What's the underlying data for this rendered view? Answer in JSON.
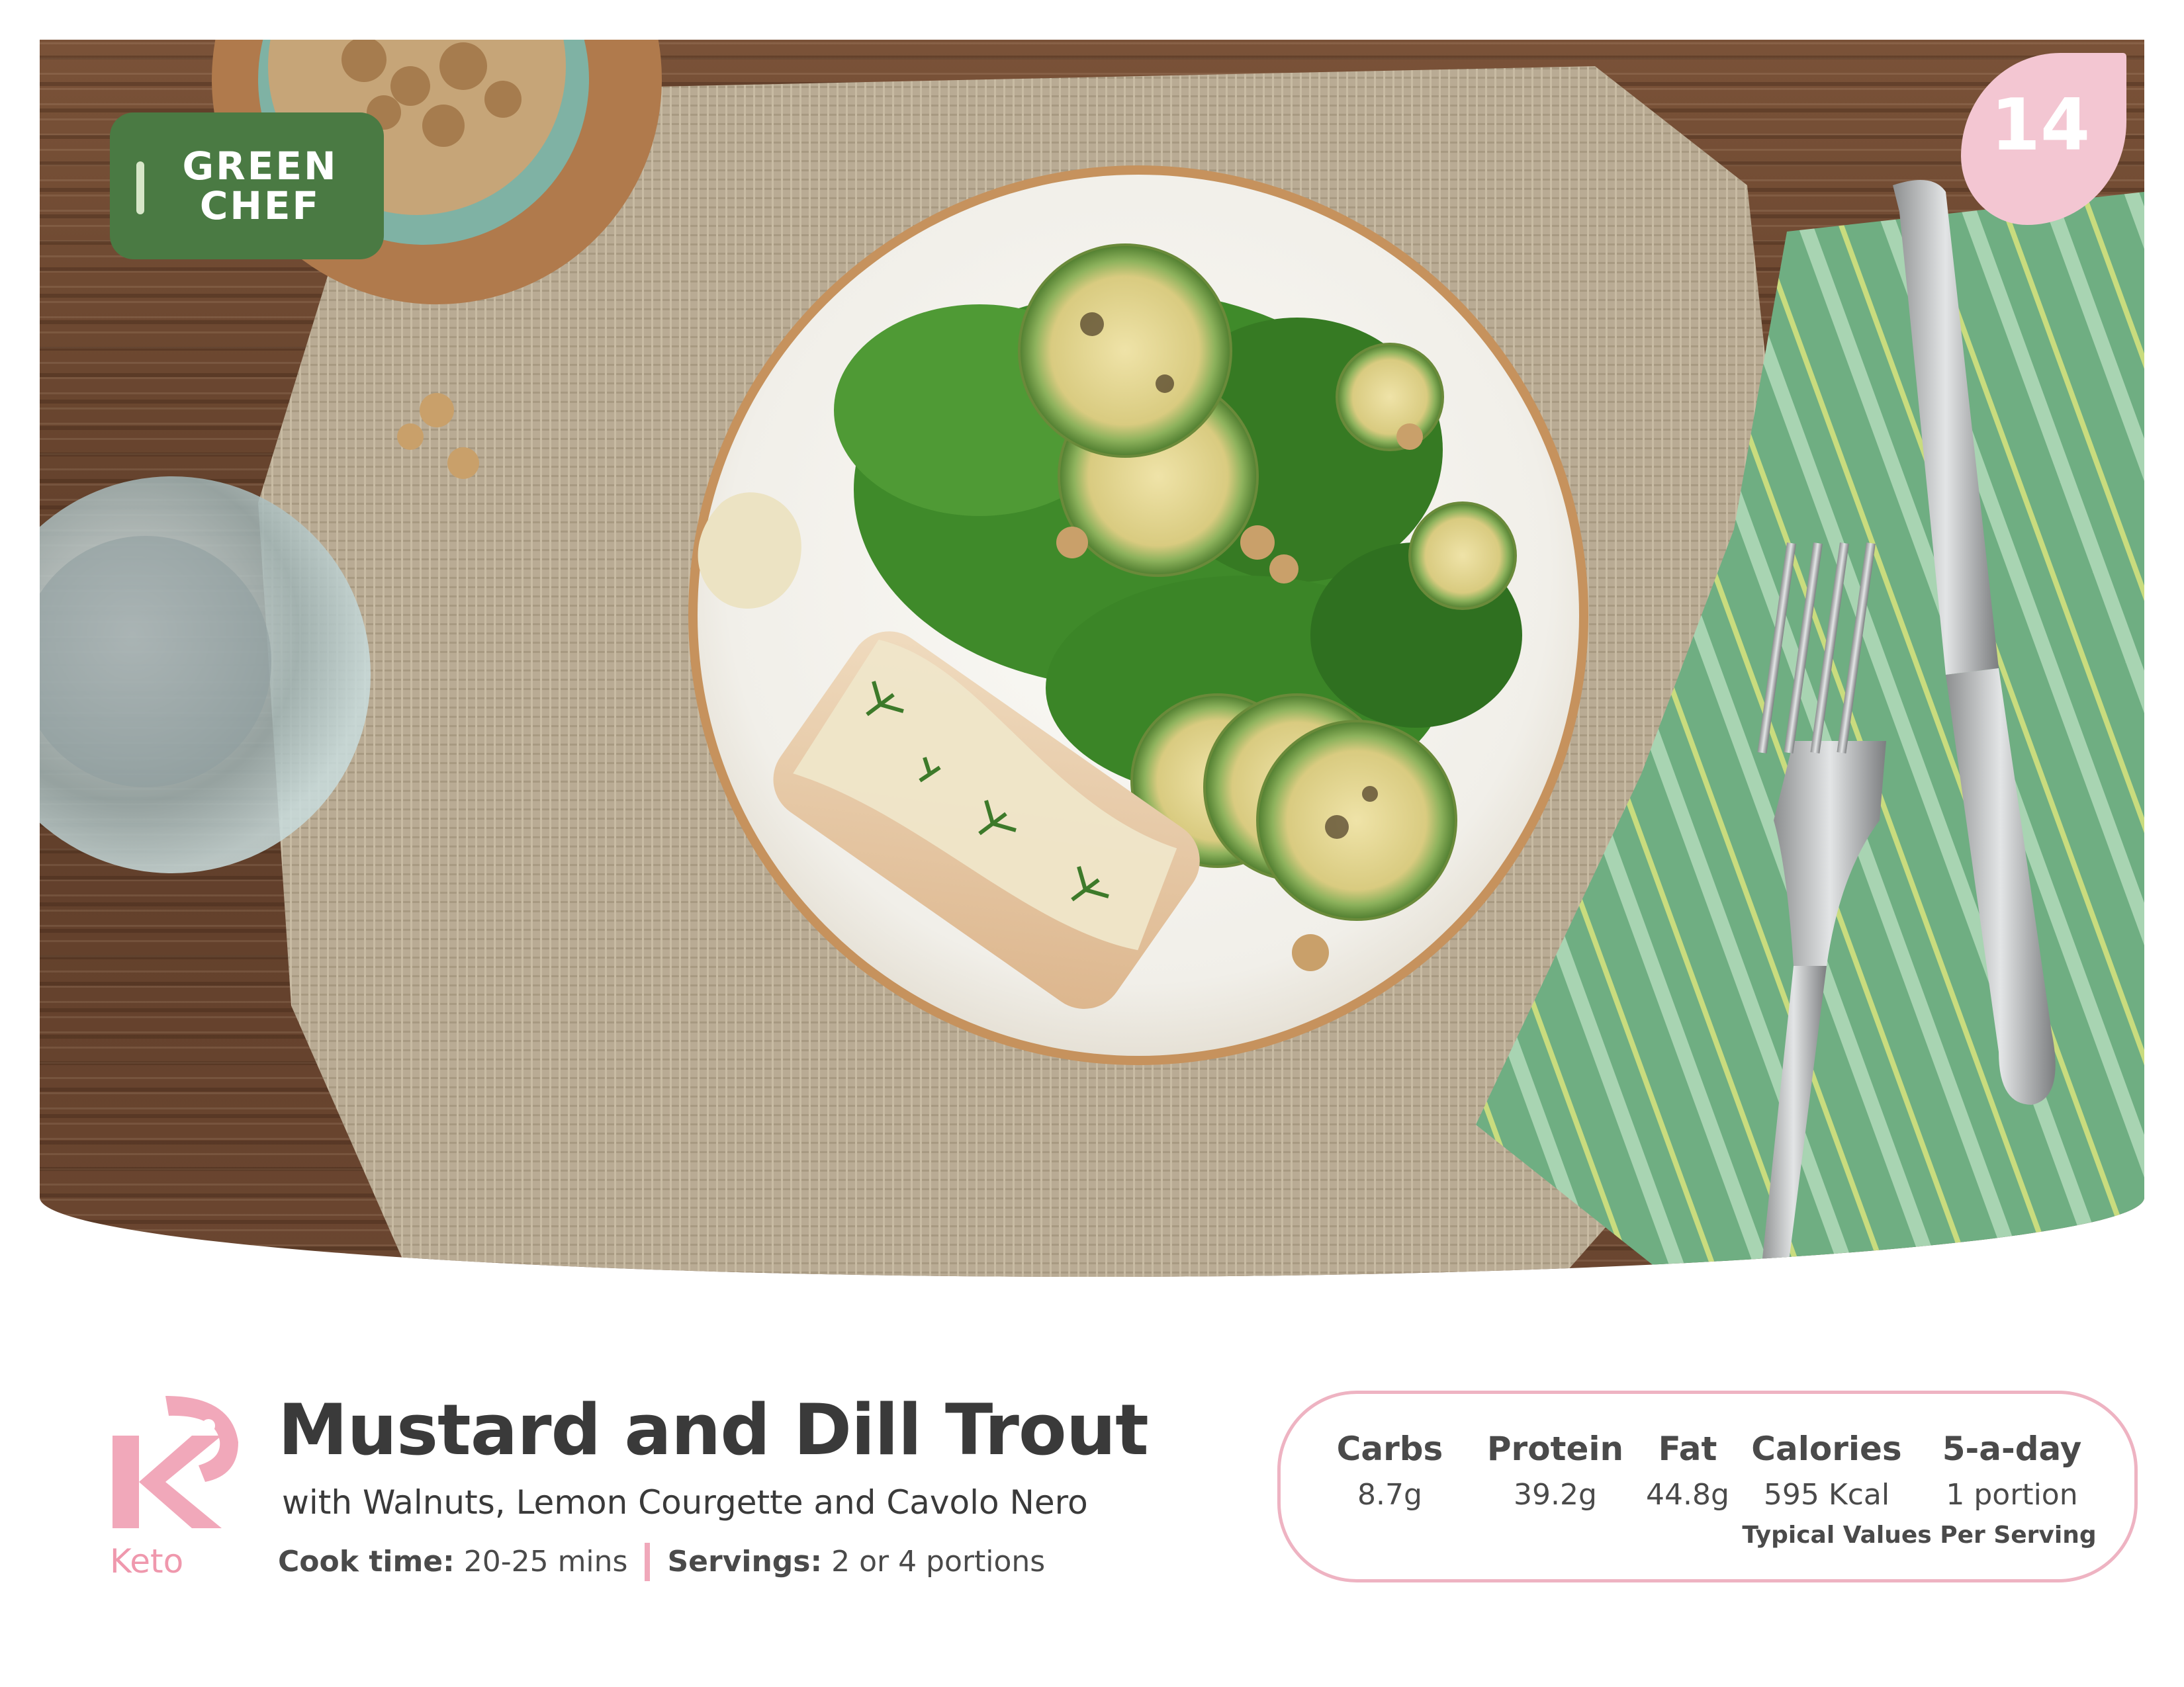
{
  "brand": {
    "line1": "GREEN",
    "line2": "CHEF"
  },
  "recipe_number": "14",
  "diet_badge": {
    "label": "Keto",
    "icon": "keto-k-icon",
    "color": "#ef98ad"
  },
  "recipe": {
    "title": "Mustard and Dill Trout",
    "subtitle": "with Walnuts, Lemon Courgette and Cavolo Nero",
    "cook_time_label": "Cook time:",
    "cook_time_value": "20-25 mins",
    "servings_label": "Servings:",
    "servings_value": "2 or 4 portions"
  },
  "nutrition": {
    "items": [
      {
        "label": "Carbs",
        "value": "8.7g"
      },
      {
        "label": "Protein",
        "value": "39.2g"
      },
      {
        "label": "Fat",
        "value": "44.8g"
      },
      {
        "label": "Calories",
        "value": "595 Kcal"
      },
      {
        "label": "5-a-day",
        "value": "1 portion"
      }
    ],
    "note": "Typical Values Per Serving"
  },
  "colors": {
    "brand_green": "#4a7a43",
    "accent_pink": "#f3c6d2",
    "border_pink": "#eeb3c2",
    "text_dark": "#3a3a3a"
  }
}
